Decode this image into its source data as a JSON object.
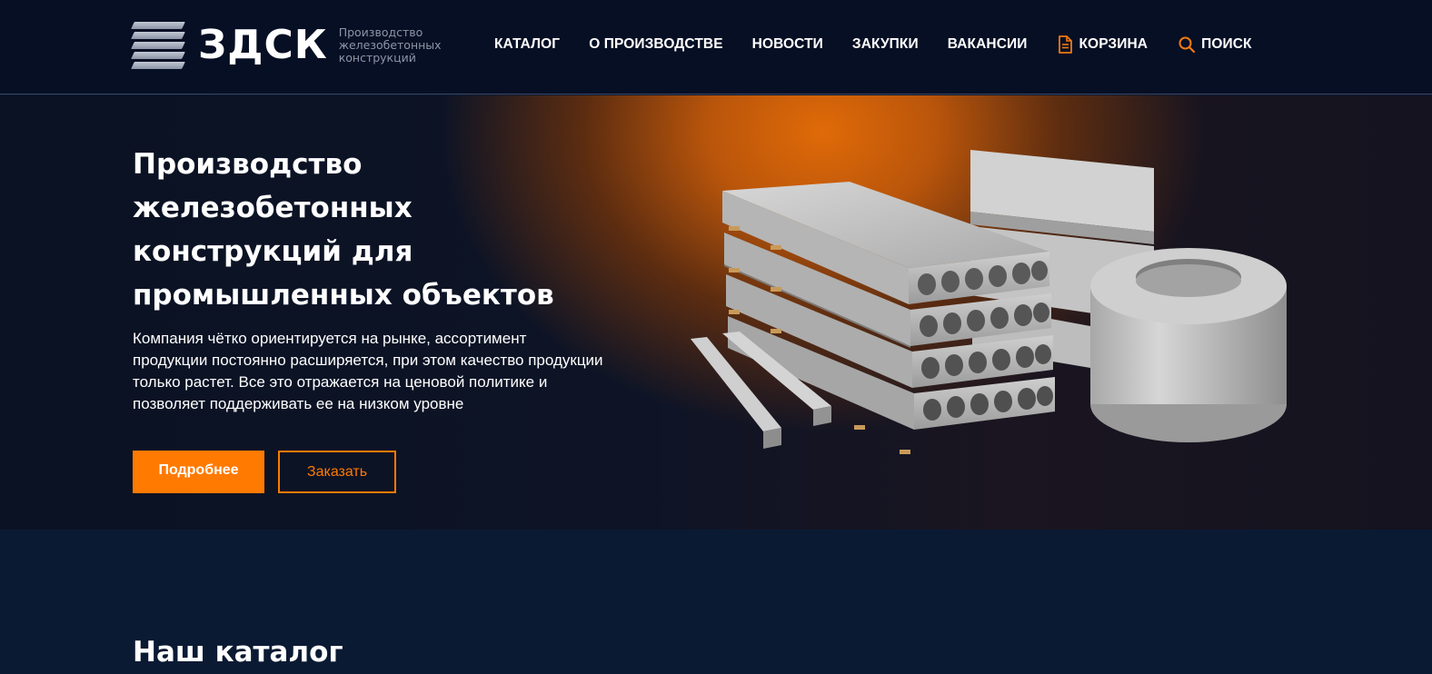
{
  "header": {
    "logo_name": "ЗДСК",
    "logo_subtitle": "Производство железобетонных конструкций",
    "nav": [
      {
        "label": "КАТАЛОГ",
        "icon": "grid-icon"
      },
      {
        "label": "О ПРОИЗВОДСТВЕ"
      },
      {
        "label": "НОВОСТИ"
      },
      {
        "label": "ЗАКУПКИ"
      },
      {
        "label": "ВАКАНСИИ"
      },
      {
        "label": "КОРЗИНА",
        "icon": "document-icon"
      },
      {
        "label": "ПОИСК",
        "icon": "search-icon"
      }
    ]
  },
  "hero": {
    "title": "Производство железобетонных конструкций для промышленных объектов",
    "text": "Компания чётко ориентируется на рынке, ассортимент продукции постоянно расширяется, при этом качество продукции только растет. Все это отражается на ценовой политике и позволяет поддерживать ее на низком уровне",
    "primary_button": "Подробнее",
    "secondary_button": "Заказать",
    "image": "concrete-products-image"
  },
  "catalog": {
    "title": "Наш каталог"
  },
  "colors": {
    "accent": "#ff7a00",
    "header_bg": "#060f24",
    "page_bg": "#0b1a33"
  }
}
